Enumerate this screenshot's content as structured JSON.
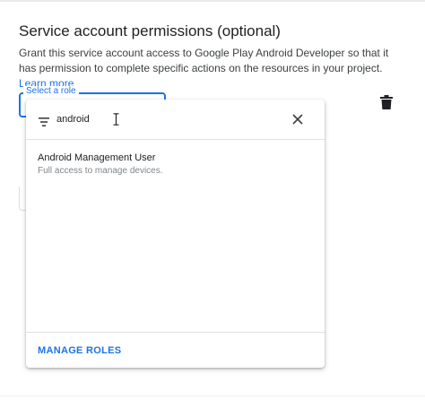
{
  "section": {
    "title": "Service account permissions (optional)",
    "description": "Grant this service account access to Google Play Android Developer so that it has permission to complete specific actions on the resources in your project.",
    "learn_more": "Learn more"
  },
  "role_select": {
    "label": "Select a role"
  },
  "dropdown": {
    "filter_value": "android",
    "options": [
      {
        "name": "Android Management User",
        "description": "Full access to manage devices."
      }
    ],
    "footer_action": "MANAGE ROLES"
  },
  "icons": {
    "filter": "filter-icon",
    "clear": "close-icon",
    "delete": "trash-icon",
    "cursor": "text-cursor-icon"
  },
  "colors": {
    "accent": "#1a73e8",
    "text_primary": "#202124",
    "text_secondary": "#80868b",
    "icon": "#202124"
  }
}
